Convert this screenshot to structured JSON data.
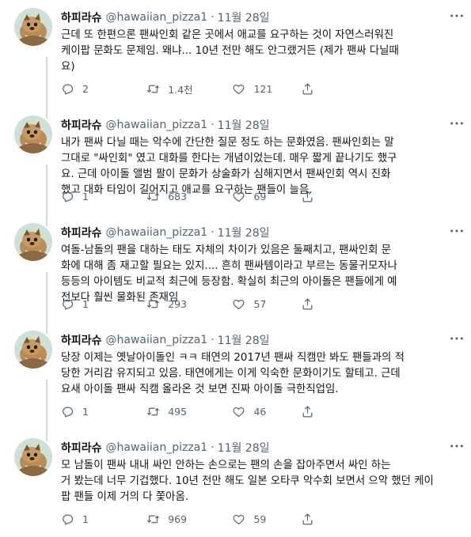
{
  "tweets": [
    {
      "name": "하피라슈",
      "handle": "@hawaiian_pizza1",
      "time": "11월 28일",
      "text": "근데 또 한편으론 팬싸인회 같은 곳에서 애교를 요구하는 것이 자연스러워진\n케이팝 문화도 문제임. 왜냐... 10년 전만 해도 안그랬거든 (제가 팬싸 다닐때\n요)",
      "replies": "2",
      "retweets": "1.4천",
      "likes": "121"
    },
    {
      "name": "하피라슈",
      "handle": "@hawaiian_pizza1",
      "time": "11월 28일",
      "text": "내가 팬싸 다닐 때는 악수에 간단한 질문 정도 하는 문화였음. 팬싸인회는 말\n그대로 \"싸인회\" 였고 대화를 한다는 개념이었는데. 매우 짧게 끝나기도 했구\n요. 근데 아이돌 앨범 팔이 문화가 상술화가 심해지면서 팬싸인회 역시 진화\n했고 대화 타임이 길어지고 애교를 요구하는 팬들이 늘음.",
      "replies": "1",
      "retweets": "683",
      "likes": "69"
    },
    {
      "name": "하피라슈",
      "handle": "@hawaiian_pizza1",
      "time": "11월 28일",
      "text": "여돌-남돌의 팬을 대하는 태도 자체의 차이가 있음은 둘째치고, 팬싸인회 문\n화에 대해 좀 재고할 필요는 있지.... 흔히 팬싸템이라고 부르는 동물귀모자나\n등등의 아이템도 비교적 최근에 등장함. 확실히 최근의 아이돌은 팬들에게 예\n전보다 훨씬 물화된 존재임",
      "replies": "1",
      "retweets": "293",
      "likes": "57"
    },
    {
      "name": "하피라슈",
      "handle": "@hawaiian_pizza1",
      "time": "11월 28일",
      "text": "당장 이제는 옛날아이돌인 ㅋㅋ 태연의 2017년 팬싸 직캠만 봐도 팬들과의 적\n당한 거리감 유지되고 있음. 태연에게는 이게 익숙한 문화이기도 할테고. 근데\n요새 아이돌 팬싸 직캠 올라온 것 보면 진짜 아이돌 극한직업임.",
      "replies": "1",
      "retweets": "495",
      "likes": "46"
    },
    {
      "name": "하피라슈",
      "handle": "@hawaiian_pizza1",
      "time": "11월 28일",
      "text": "모 남돌이 팬싸 내내 싸인 안하는 손으로는 팬의 손을 잡아주면서 싸인 하는\n거 봤는데 너무 기겁했다. 10년 전만 해도 일본 오타쿠 악수회 보면서 으악 했던 케이\n팝 팬들 이제 거의 다 쫓아옴.",
      "replies": "1",
      "retweets": "969",
      "likes": "59"
    }
  ],
  "icons": {
    "more": "more-dots-icon",
    "reply": "reply-icon",
    "retweet": "retweet-icon",
    "like": "heart-icon",
    "share": "share-icon"
  },
  "colors": {
    "text": "#0f1419",
    "secondary": "#536471",
    "thread_line": "#cfd9de"
  }
}
